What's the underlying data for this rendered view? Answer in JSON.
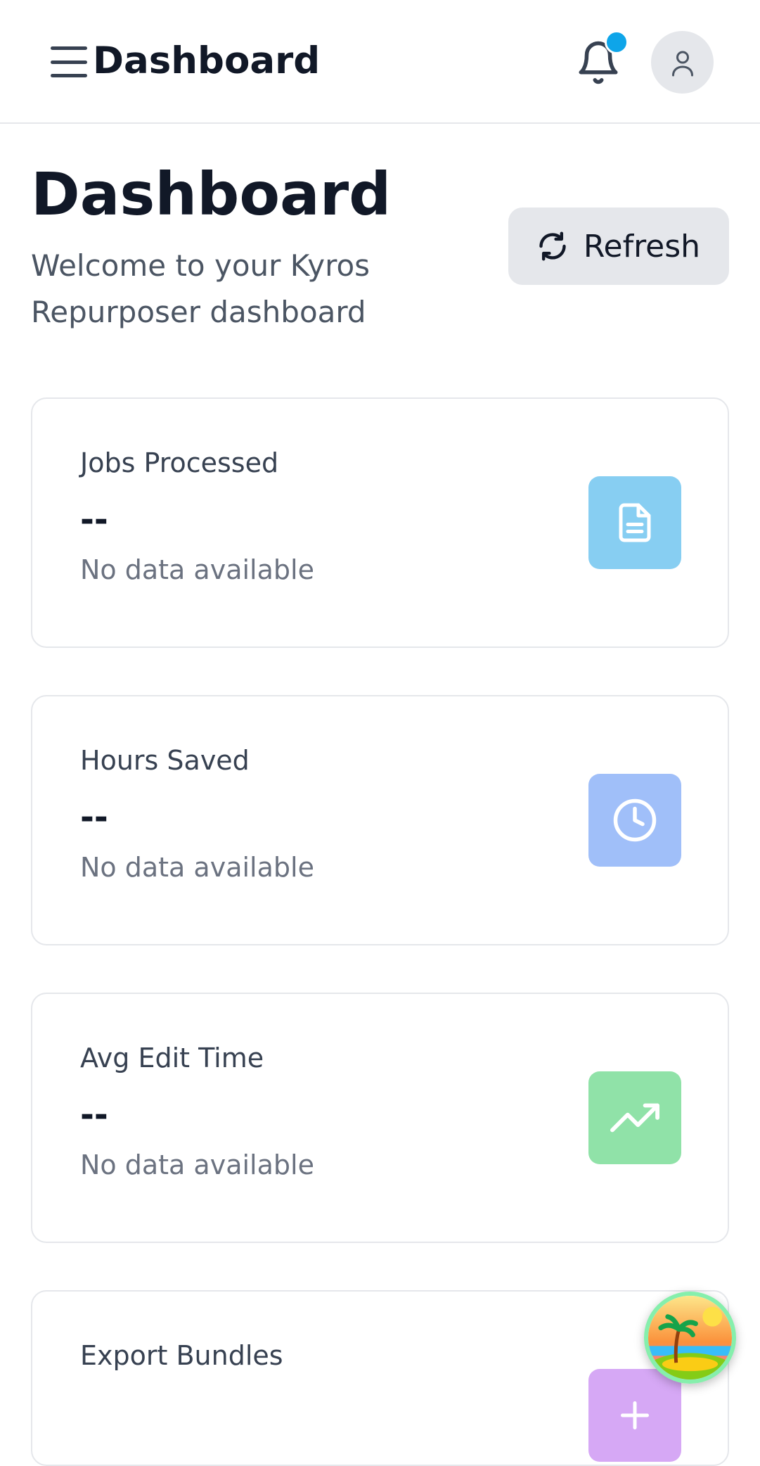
{
  "header": {
    "title": "Dashboard",
    "menu_icon": "hamburger-menu-icon",
    "notification_icon": "bell-icon",
    "avatar_icon": "user-icon"
  },
  "page": {
    "heading": "Dashboard",
    "subtitle": "Welcome to your Kyros Repurposer dashboard",
    "refresh_label": "Refresh",
    "refresh_icon": "refresh-icon"
  },
  "colors": {
    "notification_dot": "#0ea5e9",
    "jobs_icon_bg": "#87cef2",
    "hours_icon_bg": "#a0bff9",
    "avg_icon_bg": "#90e2a8",
    "export_icon_bg": "#d6a8f5"
  },
  "cards": [
    {
      "title": "Jobs Processed",
      "value": "--",
      "note": "No data available",
      "icon": "document-icon"
    },
    {
      "title": "Hours Saved",
      "value": "--",
      "note": "No data available",
      "icon": "clock-icon"
    },
    {
      "title": "Avg Edit Time",
      "value": "--",
      "note": "No data available",
      "icon": "trending-up-icon"
    },
    {
      "title": "Export Bundles",
      "value": "",
      "note": "",
      "icon": "plus-icon"
    }
  ],
  "floating_button": {
    "icon": "island-beach-icon"
  }
}
